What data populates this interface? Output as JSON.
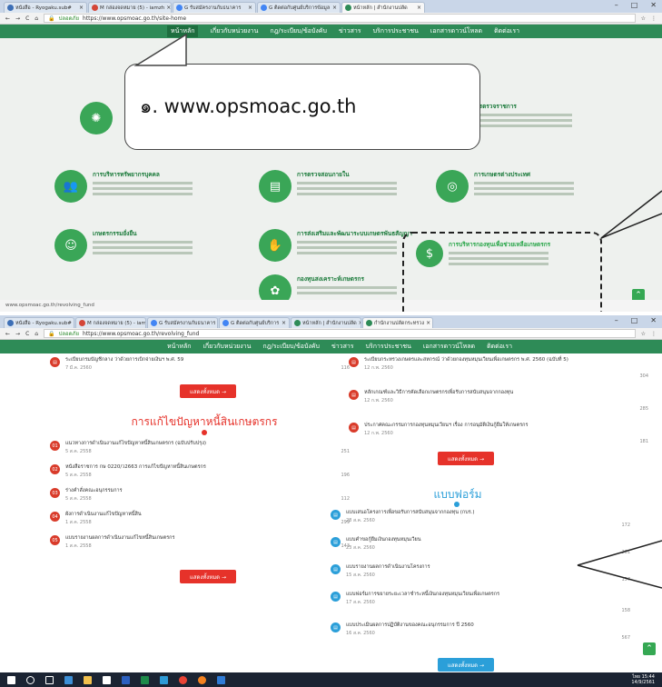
{
  "window1": {
    "tabs": [
      {
        "label": "หนังสือ - Ryogaku.sub#",
        "fav": "#3d6fb6"
      },
      {
        "label": "M กล่องจดหมาย (5) - iamzh",
        "fav": "#d44638"
      },
      {
        "label": "G รับสมัครงานกับธนาคาร",
        "fav": "#4285f4"
      },
      {
        "label": "G ติดต่อกับศูนย์บริการข้อมูล",
        "fav": "#4285f4"
      },
      {
        "label": "หน้าหลัก | สำนักงานปลัด",
        "fav": "#2e8b57"
      }
    ],
    "controls": [
      "–",
      "□",
      "✕"
    ],
    "address": {
      "secure_label": "ปลอดภัย",
      "url": "https://www.opsmoac.go.th/site-home"
    },
    "nav": [
      "หน้าหลัก",
      "เกี่ยวกับหน่วยงาน",
      "กฎ/ระเบียบ/ข้อบังคับ",
      "ข่าวสาร",
      "บริการประชาชน",
      "เอกสารดาวน์โหลด",
      "ติดต่อเรา"
    ],
    "callout_text": "๑. www.opsmoac.go.th",
    "cards": [
      {
        "title": "การตรวจราชการ",
        "icon": "inspect-icon"
      },
      {
        "title": "การบริหารทรัพยากรบุคคล",
        "icon": "people-icon"
      },
      {
        "title": "การตรวจสอบภายใน",
        "icon": "document-icon"
      },
      {
        "title": "การเกษตรต่างประเทศ",
        "icon": "globe-icon"
      },
      {
        "title": "เกษตรกรรมยั่งยืน",
        "icon": "farmer-icon"
      },
      {
        "title": "การส่งเสริมและพัฒนาระบบเกษตรพันธสัญญา",
        "icon": "handshake-icon"
      },
      {
        "title": "การบริหารกองทุนเพื่อช่วยเหลือเกษตรกร",
        "icon": "fund-icon"
      },
      {
        "title": "กองทุนสงเคราะห์เกษตรกร",
        "icon": "fafr-icon"
      }
    ],
    "status_url": "www.opsmoac.go.th/revolving_fund"
  },
  "window2": {
    "tabs": [
      {
        "label": "หนังสือ - Ryogaku.sub#",
        "fav": "#3d6fb6"
      },
      {
        "label": "M กล่องจดหมาย (5) - iamzh",
        "fav": "#d44638"
      },
      {
        "label": "G รับสมัครงานกับธนาคาร",
        "fav": "#4285f4"
      },
      {
        "label": "G ติดต่อกับศูนย์บริการ",
        "fav": "#4285f4"
      },
      {
        "label": "หน้าหลัก | สำนักงานปลัด",
        "fav": "#2e8b57"
      },
      {
        "label": "กำนักงานปลัดกระทรวง",
        "fav": "#2e8b57"
      }
    ],
    "address": {
      "secure_label": "ปลอดภัย",
      "url": "https://www.opsmoac.go.th/revolving_fund"
    },
    "nav": [
      "หน้าหลัก",
      "เกี่ยวกับหน่วยงาน",
      "กฎ/ระเบียบ/ข้อบังคับ",
      "ข่าวสาร",
      "บริการประชาชน",
      "เอกสารดาวน์โหลด",
      "ติดต่อเรา"
    ],
    "left_top_item": {
      "title": "ระเบียบกรมบัญชีกลาง ว่าด้วยการเบิกจ่ายเงินฯ พ.ศ. 59",
      "date": "7 มี.ค. 2560",
      "views": "116"
    },
    "more_label": "แสดงทั้งหมด →",
    "right_top_items": [
      {
        "title": "ระเบียบกระทรวงเกษตรและสหกรณ์ ว่าด้วยกองทุนหมุนเวียนเพื่อเกษตรกร พ.ศ. 2560 (ฉบับที่ 5)",
        "date": "12 ก.พ. 2560",
        "views": "304"
      },
      {
        "title": "หลักเกณฑ์และวิธีการคัดเลือกเกษตรกรเพื่อรับการสนับสนุนจากกองทุน",
        "date": "12 ก.พ. 2560",
        "views": "285"
      },
      {
        "title": "ประกาศคณะกรรมการกองทุนหมุนเวียนฯ เรื่อง การอนุมัติเงินกู้ยืมให้เกษตรกร",
        "date": "12 ก.พ. 2560",
        "views": "181"
      }
    ],
    "debt_heading": "การแก้ไขปัญหาหนี้สินเกษตรกร",
    "debt_items": [
      {
        "num": "01",
        "title": "แนวทางการดำเนินงานแก้ไขปัญหาหนี้สินเกษตรกร (ฉบับปรับปรุง)",
        "date": "5 ส.ค. 2558",
        "views": "251"
      },
      {
        "num": "02",
        "title": "หนังสือราชการ กษ 0220/ว2663 การแก้ไขปัญหาหนี้สินเกษตรกร",
        "date": "5 ส.ค. 2558",
        "views": "196"
      },
      {
        "num": "03",
        "title": "ร่างคำสั่งคณะอนุกรรมการ",
        "date": "5 ส.ค. 2558",
        "views": "112"
      },
      {
        "num": "04",
        "title": "ผังการดำเนินงานแก้ไขปัญหาหนี้สิน",
        "date": "1 ส.ค. 2558",
        "views": "299"
      },
      {
        "num": "05",
        "title": "แบบรายงานผลการดำเนินงานแก้ไขหนี้สินเกษตรกร",
        "date": "1 ส.ค. 2558",
        "views": "143"
      }
    ],
    "form_heading": "แบบฟอร์ม",
    "form_items": [
      {
        "title": "แบบเสนอโครงการเพื่อขอรับการสนับสนุนจากกองทุน (กบร.)",
        "date": "28 ส.ค. 2560",
        "views": "172"
      },
      {
        "title": "แบบคำขอกู้ยืมเงินกองทุนหมุนเวียน",
        "date": "23 ส.ค. 2560",
        "views": "261"
      },
      {
        "title": "แบบรายงานผลการดำเนินงานโครงการ",
        "date": "15 ส.ค. 2560",
        "views": "157"
      },
      {
        "title": "แบบฟอร์มการขยายระยะเวลาชำระหนี้เงินกองทุนหมุนเวียนเพื่อเกษตรกร",
        "date": "17 ส.ค. 2560",
        "views": "158"
      },
      {
        "title": "แบบประเมินผลการปฏิบัติงานของคณะอนุกรรมการ ปี 2560",
        "date": "16 ส.ค. 2560",
        "views": "567"
      }
    ]
  },
  "taskbar": {
    "time": "15:44",
    "date": "14/9/2561",
    "lang": "ไทย"
  }
}
